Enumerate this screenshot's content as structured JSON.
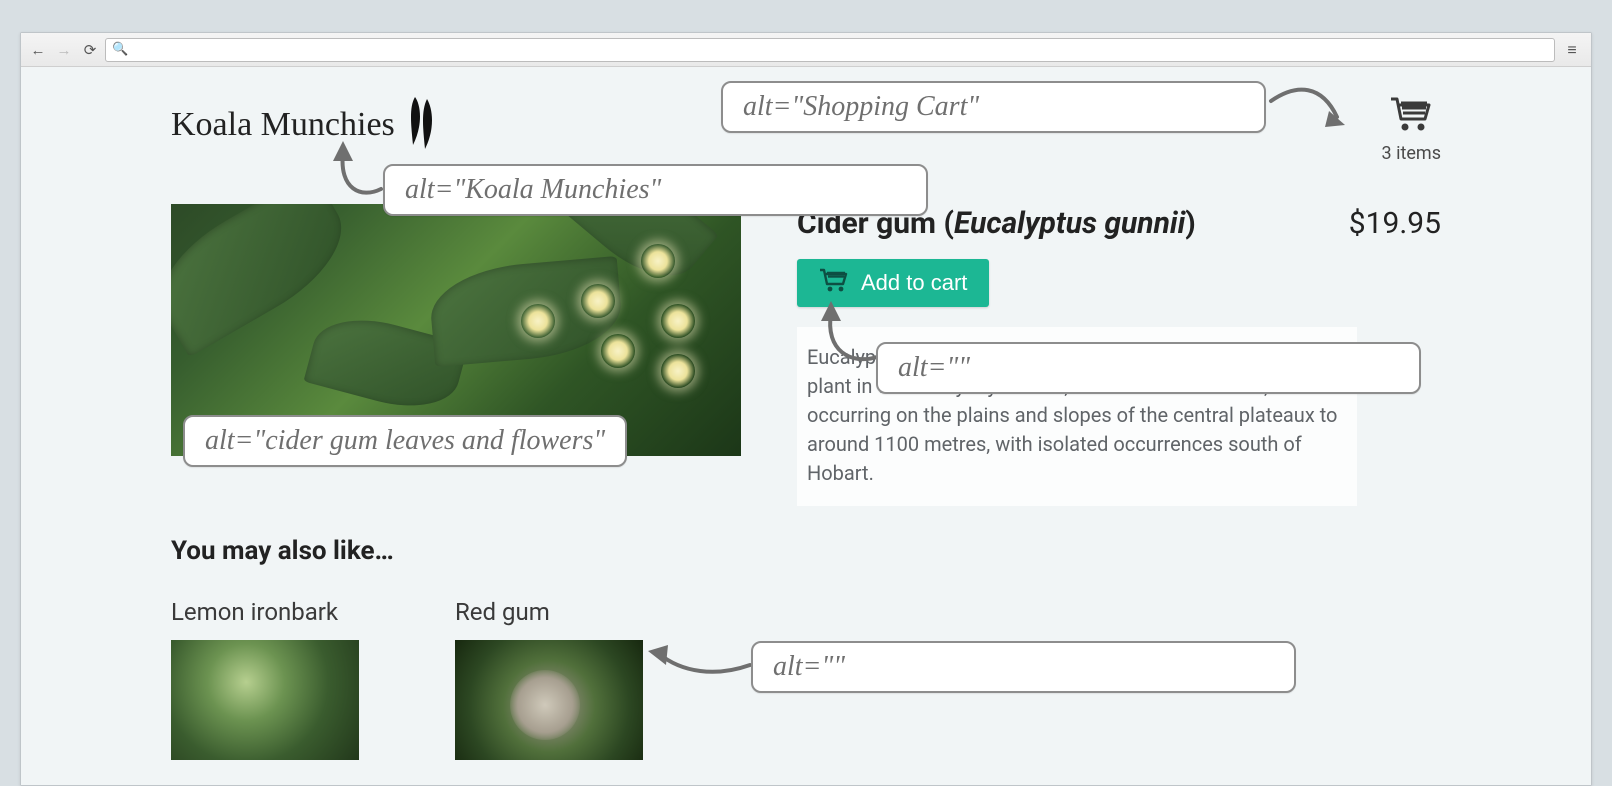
{
  "header": {
    "site_name": "Koala Munchies",
    "cart_items_label": "3 items"
  },
  "product": {
    "title_pre": "Cider gum (",
    "title_sci": "Eucalyptus gunnii",
    "title_post": ")",
    "price": "$19.95",
    "add_label": "Add to cart",
    "description": "Eucalyptus gunnii, the cider gum, is a species of flowering plant in the family Myrtaceae, endemic to Tasmania, occurring on the plains and slopes of the central plateaux to around 1100 metres, with isolated occurrences south of Hobart."
  },
  "related": {
    "heading": "You may also like…",
    "items": [
      {
        "name": "Lemon ironbark"
      },
      {
        "name": "Red gum"
      }
    ]
  },
  "annotations": {
    "logo_alt": "alt=\"Koala Munchies\"",
    "cart_alt": "alt=\"Shopping Cart\"",
    "hero_alt": "alt=\"cider gum leaves and flowers\"",
    "cart_icon_in_button_alt": "alt=\"\"",
    "related_img_alt": "alt=\"\""
  }
}
